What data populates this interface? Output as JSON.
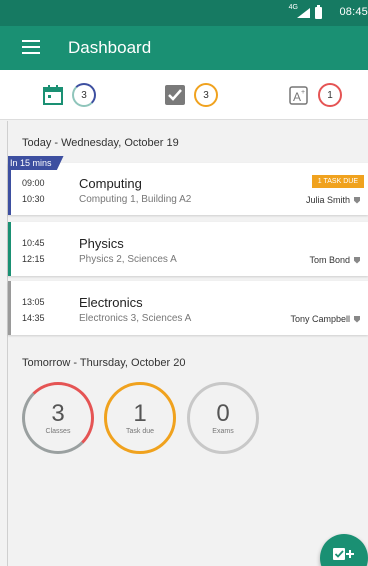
{
  "status_bar": {
    "network": "4G",
    "time": "08:45"
  },
  "app_bar": {
    "title": "Dashboard"
  },
  "summary": {
    "classes_count": "3",
    "tasks_count": "3",
    "exams_count": "1"
  },
  "today": {
    "heading": "Today - Wednesday, October 19",
    "next_badge": "In 15 mins",
    "classes": [
      {
        "start": "09:00",
        "end": "10:30",
        "subject": "Computing",
        "room": "Computing 1, Building A2",
        "teacher": "Julia Smith",
        "task_badge": "1 TASK DUE",
        "stripe_color": "#3d4fa0"
      },
      {
        "start": "10:45",
        "end": "12:15",
        "subject": "Physics",
        "room": "Physics 2, Sciences A",
        "teacher": "Tom Bond",
        "stripe_color": "#1a9073"
      },
      {
        "start": "13:05",
        "end": "14:35",
        "subject": "Electronics",
        "room": "Electronics 3, Sciences A",
        "teacher": "Tony Campbell",
        "stripe_color": "#9a9a9a"
      }
    ]
  },
  "tomorrow": {
    "heading": "Tomorrow - Thursday, October 20",
    "stats": [
      {
        "value": "3",
        "label": "Classes"
      },
      {
        "value": "1",
        "label": "Task due"
      },
      {
        "value": "0",
        "label": "Exams"
      }
    ]
  },
  "colors": {
    "primary": "#1a9073",
    "status_bar": "#167a62",
    "accent_blue": "#3d4fa0",
    "warning": "#f0a21e",
    "danger": "#e55454"
  }
}
